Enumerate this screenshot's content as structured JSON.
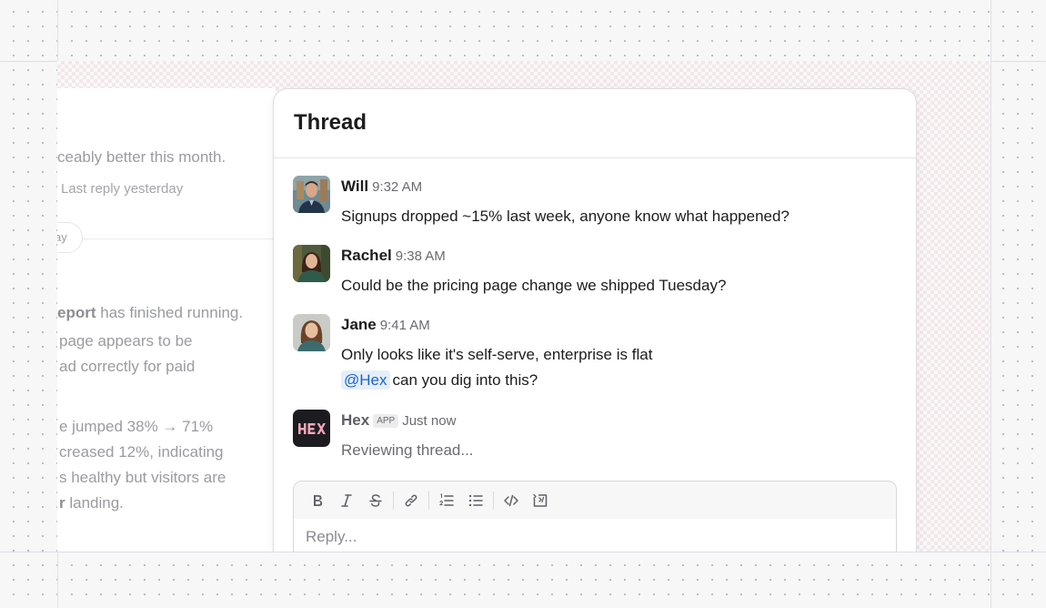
{
  "channel": {
    "line1": "ceably better this month.",
    "meta": "Last reply yesterday",
    "day_pill": "ay",
    "report_bold": "eport",
    "report_rest": " has finished running.",
    "line3": "page appears to be",
    "line4": "ad correctly for paid",
    "line5": "e jumped 38% → 71%",
    "line6": "creased 12%, indicating",
    "line7": "s healthy but visitors are",
    "line8_bold": "r",
    "line8_rest": " landing."
  },
  "thread": {
    "title": "Thread",
    "messages": [
      {
        "author": "Will",
        "time": "9:32 AM",
        "text": "Signups dropped ~15% last week, anyone know what happened?"
      },
      {
        "author": "Rachel",
        "time": "9:38 AM",
        "text": "Could be the pricing page change we shipped Tuesday?"
      },
      {
        "author": "Jane",
        "time": "9:41 AM",
        "text": "Only looks like it's self-serve, enterprise is flat",
        "mention": "@Hex",
        "text2": "can you dig into this?"
      },
      {
        "author": "Hex",
        "badge": "APP",
        "time": "Just now",
        "text": "Reviewing thread..."
      }
    ]
  },
  "composer": {
    "placeholder": "Reply...",
    "tools": [
      "bold-icon",
      "italic-icon",
      "strikethrough-icon",
      "link-icon",
      "ordered-list-icon",
      "bulleted-list-icon",
      "code-icon",
      "code-block-icon"
    ]
  },
  "colors": {
    "accent_mention": "#1a64c8",
    "hex_logo_bg": "#1c1b20",
    "hex_logo_text": "#f2a6b8"
  }
}
